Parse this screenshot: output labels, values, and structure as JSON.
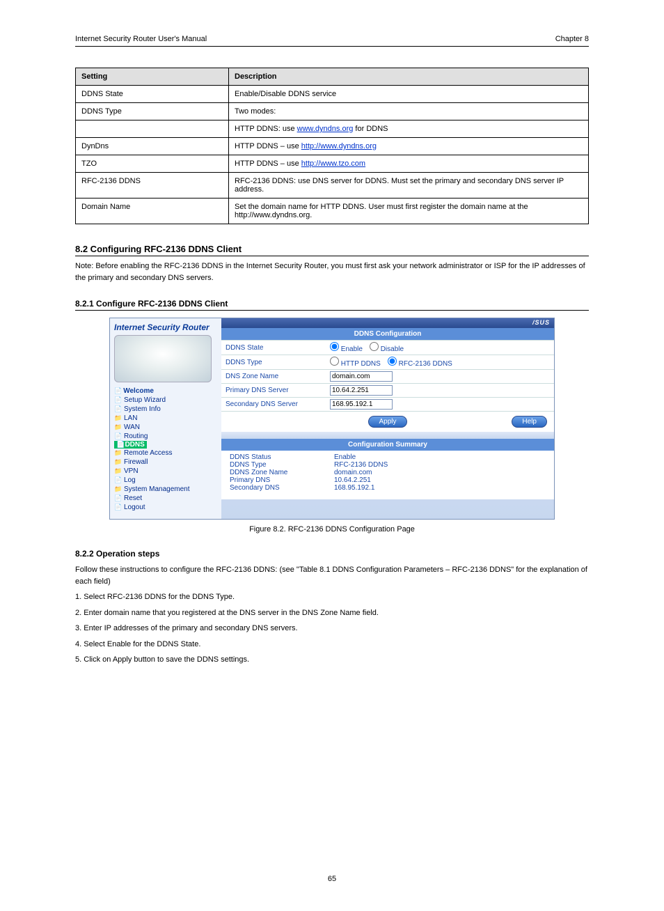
{
  "header": {
    "left": "Internet Security Router User's Manual",
    "right": "Chapter 8"
  },
  "table": {
    "th_setting": "Setting",
    "th_desc": "Description",
    "rows": [
      {
        "label": "DDNS State",
        "desc": "Enable/Disable DDNS service"
      },
      {
        "label": "DDNS Type",
        "desc": "Two modes:"
      },
      {
        "label": "",
        "desc_prefix": "HTTP DDNS: use ",
        "link_text": "www.dyndns.org",
        "desc_suffix": " for DDNS"
      },
      {
        "label": "DynDns",
        "desc_prefix": "HTTP DDNS – use ",
        "link_text": "http://www.dyndns.org",
        "desc_suffix": ""
      },
      {
        "label": "TZO",
        "desc_prefix": "HTTP DDNS – use ",
        "link_text": "http://www.tzo.com",
        "desc_suffix": ""
      },
      {
        "label": "RFC-2136 DDNS",
        "desc": "RFC-2136 DDNS: use DNS server for DDNS. Must set the primary and secondary DNS server IP address."
      },
      {
        "label": "Domain Name",
        "desc": "Set the domain name for HTTP DDNS. User must first register the domain name at the http://www.dyndns.org."
      }
    ]
  },
  "section1": {
    "title": "8.2 Configuring RFC-2136 DDNS Client",
    "body": "Note: Before enabling the RFC-2136 DDNS in the Internet Security Router, you must first ask your network administrator or ISP for the IP addresses of the primary and secondary DNS servers.",
    "sub_title": "8.2.1 Configure RFC-2136 DDNS Client"
  },
  "screenshot": {
    "brand": "Internet Security Router",
    "logo": "/SUS",
    "tree": {
      "root": "Welcome",
      "items": [
        {
          "label": "Setup Wizard",
          "type": "leaf"
        },
        {
          "label": "System Info",
          "type": "leaf"
        },
        {
          "label": "LAN",
          "type": "folder"
        },
        {
          "label": "WAN",
          "type": "folder"
        },
        {
          "label": "Routing",
          "type": "leaf"
        },
        {
          "label": "DDNS",
          "type": "sel"
        },
        {
          "label": "Remote Access",
          "type": "folder"
        },
        {
          "label": "Firewall",
          "type": "folder"
        },
        {
          "label": "VPN",
          "type": "folder"
        },
        {
          "label": "Log",
          "type": "leaf"
        },
        {
          "label": "System Management",
          "type": "folder"
        },
        {
          "label": "Reset",
          "type": "leaf"
        },
        {
          "label": "Logout",
          "type": "leaf"
        }
      ]
    },
    "cfg_title": "DDNS Configuration",
    "rows": {
      "state": {
        "label": "DDNS State",
        "opt1": "Enable",
        "opt2": "Disable"
      },
      "type": {
        "label": "DDNS Type",
        "opt1": "HTTP DDNS",
        "opt2": "RFC-2136 DDNS"
      },
      "zone": {
        "label": "DNS Zone Name",
        "value": "domain.com"
      },
      "pdns": {
        "label": "Primary DNS Server",
        "value": "10.64.2.251"
      },
      "sdns": {
        "label": "Secondary DNS Server",
        "value": "168.95.192.1"
      }
    },
    "apply": "Apply",
    "help": "Help",
    "summary_title": "Configuration Summary",
    "summary": [
      {
        "k": "DDNS Status",
        "v": "Enable"
      },
      {
        "k": "DDNS Type",
        "v": "RFC-2136 DDNS"
      },
      {
        "k": "DDNS Zone Name",
        "v": "domain.com"
      },
      {
        "k": "Primary DNS",
        "v": "10.64.2.251"
      },
      {
        "k": "Secondary DNS",
        "v": "168.95.192.1"
      }
    ]
  },
  "fig_caption": "Figure 8.2. RFC-2136 DDNS Configuration Page",
  "steps": {
    "sub2": "8.2.2 Operation steps",
    "body": "Follow these instructions to configure the RFC-2136 DDNS: (see \"Table 8.1 DDNS Configuration Parameters – RFC-2136 DDNS\" for the explanation of each field)",
    "s1_n": "1.",
    "s1": "Select RFC-2136 DDNS for the DDNS Type.",
    "s2_n": "2.",
    "s2": "Enter domain name that you registered at the DNS server in the DNS Zone Name field.",
    "s3_n": "3.",
    "s3": "Enter IP addresses of the primary and secondary DNS servers.",
    "s4_n": "4.",
    "s4": "Select Enable for the DDNS State.",
    "s5_n": "5.",
    "s5": "Click on Apply button to save the DDNS settings."
  },
  "footer": "65"
}
